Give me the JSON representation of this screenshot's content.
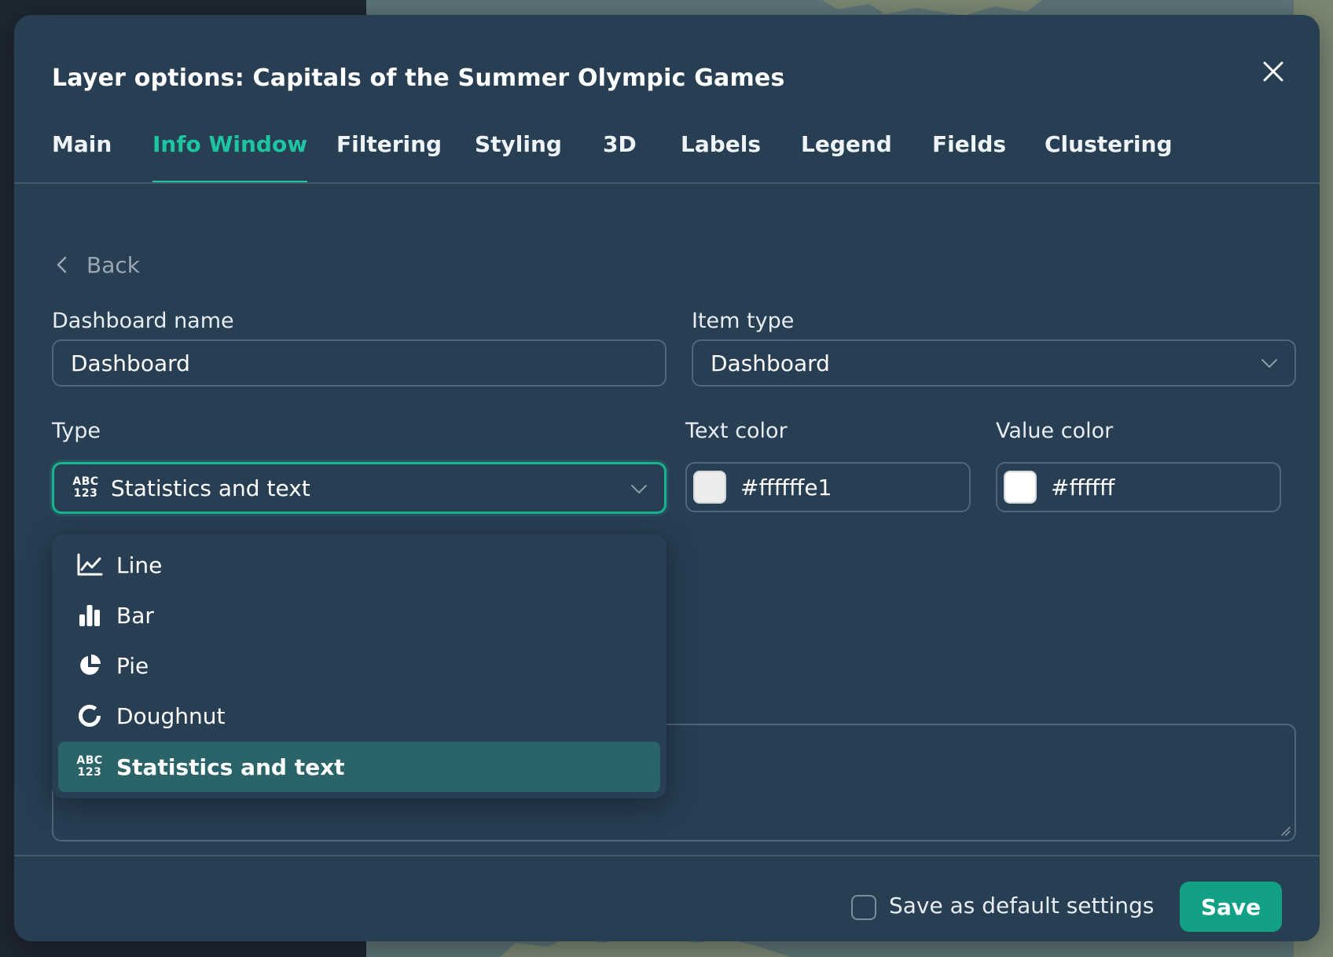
{
  "dialog": {
    "title": "Layer options: Capitals of the Summer Olympic Games"
  },
  "tabs": [
    {
      "label": "Main"
    },
    {
      "label": "Info Window",
      "active": true
    },
    {
      "label": "Filtering"
    },
    {
      "label": "Styling"
    },
    {
      "label": "3D"
    },
    {
      "label": "Labels"
    },
    {
      "label": "Legend"
    },
    {
      "label": "Fields"
    },
    {
      "label": "Clustering"
    }
  ],
  "back_label": "Back",
  "form": {
    "dashboard_name": {
      "label": "Dashboard name",
      "value": "Dashboard"
    },
    "item_type": {
      "label": "Item type",
      "value": "Dashboard"
    },
    "type": {
      "label": "Type",
      "value": "Statistics and text",
      "icon_text_top": "ABC",
      "icon_text_bottom": "123"
    },
    "text_color": {
      "label": "Text color",
      "value": "#ffffffe1",
      "swatch": "#ececec"
    },
    "value_color": {
      "label": "Value color",
      "value": "#ffffff",
      "swatch": "#ffffff"
    }
  },
  "type_options": [
    {
      "label": "Line",
      "icon": "line-chart-icon"
    },
    {
      "label": "Bar",
      "icon": "bar-chart-icon"
    },
    {
      "label": "Pie",
      "icon": "pie-chart-icon"
    },
    {
      "label": "Doughnut",
      "icon": "doughnut-chart-icon"
    },
    {
      "label": "Statistics and text",
      "icon": "abc-123-icon",
      "selected": true
    }
  ],
  "footer": {
    "default_checkbox_label": "Save as default settings",
    "save_label": "Save"
  },
  "colors": {
    "accent": "#1cc6a0",
    "modal_bg": "#283e53",
    "save_bg": "#12a184",
    "selected_option_bg": "#2a6468"
  }
}
